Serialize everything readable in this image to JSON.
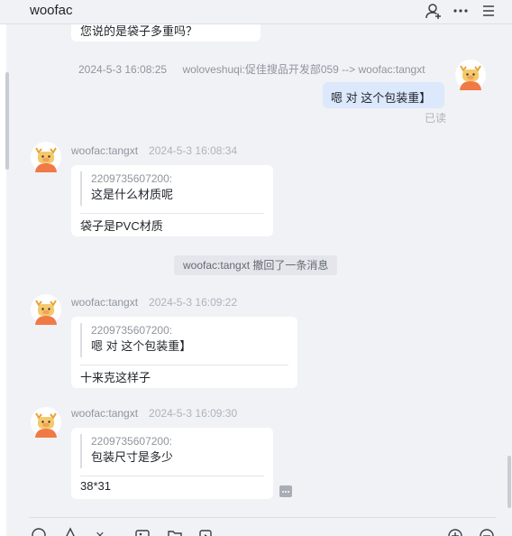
{
  "header": {
    "title": "woofac"
  },
  "messages": {
    "partial_top": {
      "text": "您说的是袋子多重吗？"
    },
    "m1": {
      "time": "2024-5-3 16:08:25",
      "route": "woloveshuqi:促佳搜品开发部059 --> woofac:tangxt",
      "text": "嗯  对 这个包装重】",
      "status": "已读"
    },
    "m2": {
      "name": "woofac:tangxt",
      "time": "2024-5-3 16:08:34",
      "quote_name": "2209735607200:",
      "quote_text": "这是什么材质呢",
      "text": "袋子是PVC材质"
    },
    "system": {
      "text": "woofac:tangxt 撤回了一条消息"
    },
    "m3": {
      "name": "woofac:tangxt",
      "time": "2024-5-3 16:09:22",
      "quote_name": "2209735607200:",
      "quote_text": "嗯  对 这个包装重】",
      "text": "十来克这样子"
    },
    "m4": {
      "name": "woofac:tangxt",
      "time": "2024-5-3 16:09:30",
      "quote_name": "2209735607200:",
      "quote_text": "包装尺寸是多少",
      "text": "38*31"
    }
  },
  "colors": {
    "background": "#f1f2f6",
    "mine_bubble": "#dce8fb",
    "other_bubble": "#ffffff",
    "avatar_face": "#f08a4b"
  },
  "icons": {
    "header": [
      "add-contact-icon",
      "more-dots-icon",
      "menu-icon"
    ],
    "toolbar": [
      "emoji-icon",
      "font-icon",
      "scissors-icon",
      "image-icon",
      "folder-icon",
      "history-icon",
      "add-icon",
      "chat-icon"
    ]
  }
}
